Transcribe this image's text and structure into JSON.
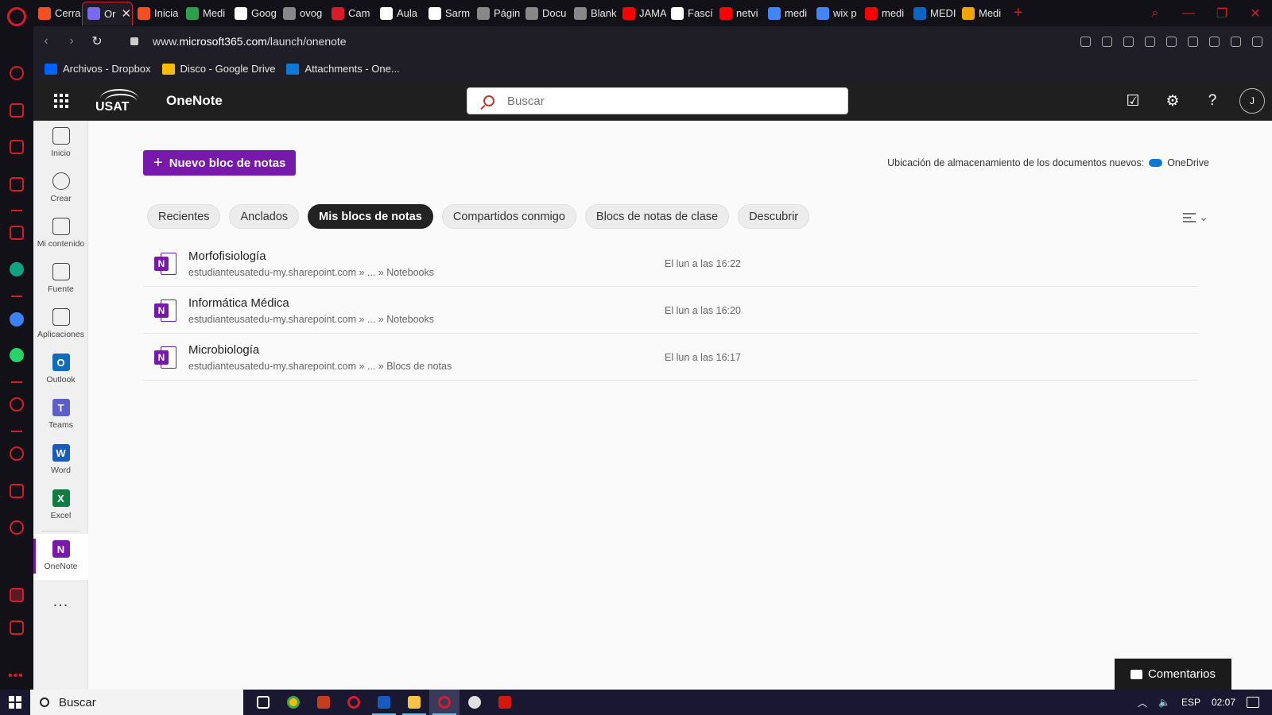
{
  "browser": {
    "tabs": [
      {
        "label": "Cerra",
        "color": "#f25022"
      },
      {
        "label": "Or",
        "color": "#7b68ee",
        "active": true
      },
      {
        "label": "Inicia",
        "color": "#f25022"
      },
      {
        "label": "Medi",
        "color": "#2e9e4f"
      },
      {
        "label": "Goog",
        "color": "#ffffff"
      },
      {
        "label": "ovog",
        "color": "#888888"
      },
      {
        "label": "Cam",
        "color": "#d81b2a"
      },
      {
        "label": "Aula",
        "color": "#ffffff"
      },
      {
        "label": "Sarm",
        "color": "#ffffff"
      },
      {
        "label": "Págin",
        "color": "#888888"
      },
      {
        "label": "Docu",
        "color": "#888888"
      },
      {
        "label": "Blank",
        "color": "#888888"
      },
      {
        "label": "JAMA",
        "color": "#ff0000"
      },
      {
        "label": "Fascí",
        "color": "#ffffff"
      },
      {
        "label": "netvi",
        "color": "#ff0000"
      },
      {
        "label": "medi",
        "color": "#4285f4"
      },
      {
        "label": "wix p",
        "color": "#4285f4"
      },
      {
        "label": "medi",
        "color": "#ff0000"
      },
      {
        "label": "MEDI",
        "color": "#0a66c2"
      },
      {
        "label": "Medi",
        "color": "#f0a500"
      }
    ],
    "url_prefix": "www.",
    "url_domain": "microsoft365.com",
    "url_path": "/launch/onenote",
    "bookmarks": [
      {
        "label": "Archivos - Dropbox",
        "color": "#0061ff"
      },
      {
        "label": "Disco - Google Drive",
        "color": "#fbbc04"
      },
      {
        "label": "Attachments - One...",
        "color": "#0f78d4"
      }
    ]
  },
  "header": {
    "logo_text": "USAT",
    "app_name": "OneNote",
    "search_placeholder": "Buscar",
    "avatar_initial": "J"
  },
  "rail": {
    "items": [
      {
        "label": "Inicio"
      },
      {
        "label": "Crear"
      },
      {
        "label": "Mi contenido"
      },
      {
        "label": "Fuente"
      },
      {
        "label": "Aplicaciones"
      },
      {
        "label": "Outlook",
        "glyph": "O",
        "color": "#0f6cbd"
      },
      {
        "label": "Teams",
        "glyph": "T",
        "color": "#5b5fc7"
      },
      {
        "label": "Word",
        "glyph": "W",
        "color": "#185abd"
      },
      {
        "label": "Excel",
        "glyph": "X",
        "color": "#107c41"
      },
      {
        "label": "OneNote",
        "glyph": "N",
        "color": "#7719aa"
      }
    ],
    "more": "..."
  },
  "main": {
    "new_button_label": "Nuevo bloc de notas",
    "storage_label": "Ubicación de almacenamiento de los documentos nuevos:",
    "storage_target": "OneDrive",
    "filter_tabs": [
      "Recientes",
      "Anclados",
      "Mis blocs de notas",
      "Compartidos conmigo",
      "Blocs de notas de clase",
      "Descubrir"
    ],
    "active_tab": "Mis blocs de notas",
    "notebooks": [
      {
        "title": "Morfofisiología",
        "path": "estudianteusatedu-my.sharepoint.com » ... » Notebooks",
        "date": "El lun a las 16:22"
      },
      {
        "title": "Informática Médica",
        "path": "estudianteusatedu-my.sharepoint.com » ... » Notebooks",
        "date": "El lun a las 16:20"
      },
      {
        "title": "Microbiología",
        "path": "estudianteusatedu-my.sharepoint.com » ... » Blocs de notas",
        "date": "El lun a las 16:17"
      }
    ],
    "feedback_label": "Comentarios"
  },
  "taskbar": {
    "search_label": "Buscar",
    "language": "ESP",
    "time": "02:07"
  },
  "colors": {
    "onenote_purple": "#7719aa",
    "opera_red": "#d81b2a"
  }
}
